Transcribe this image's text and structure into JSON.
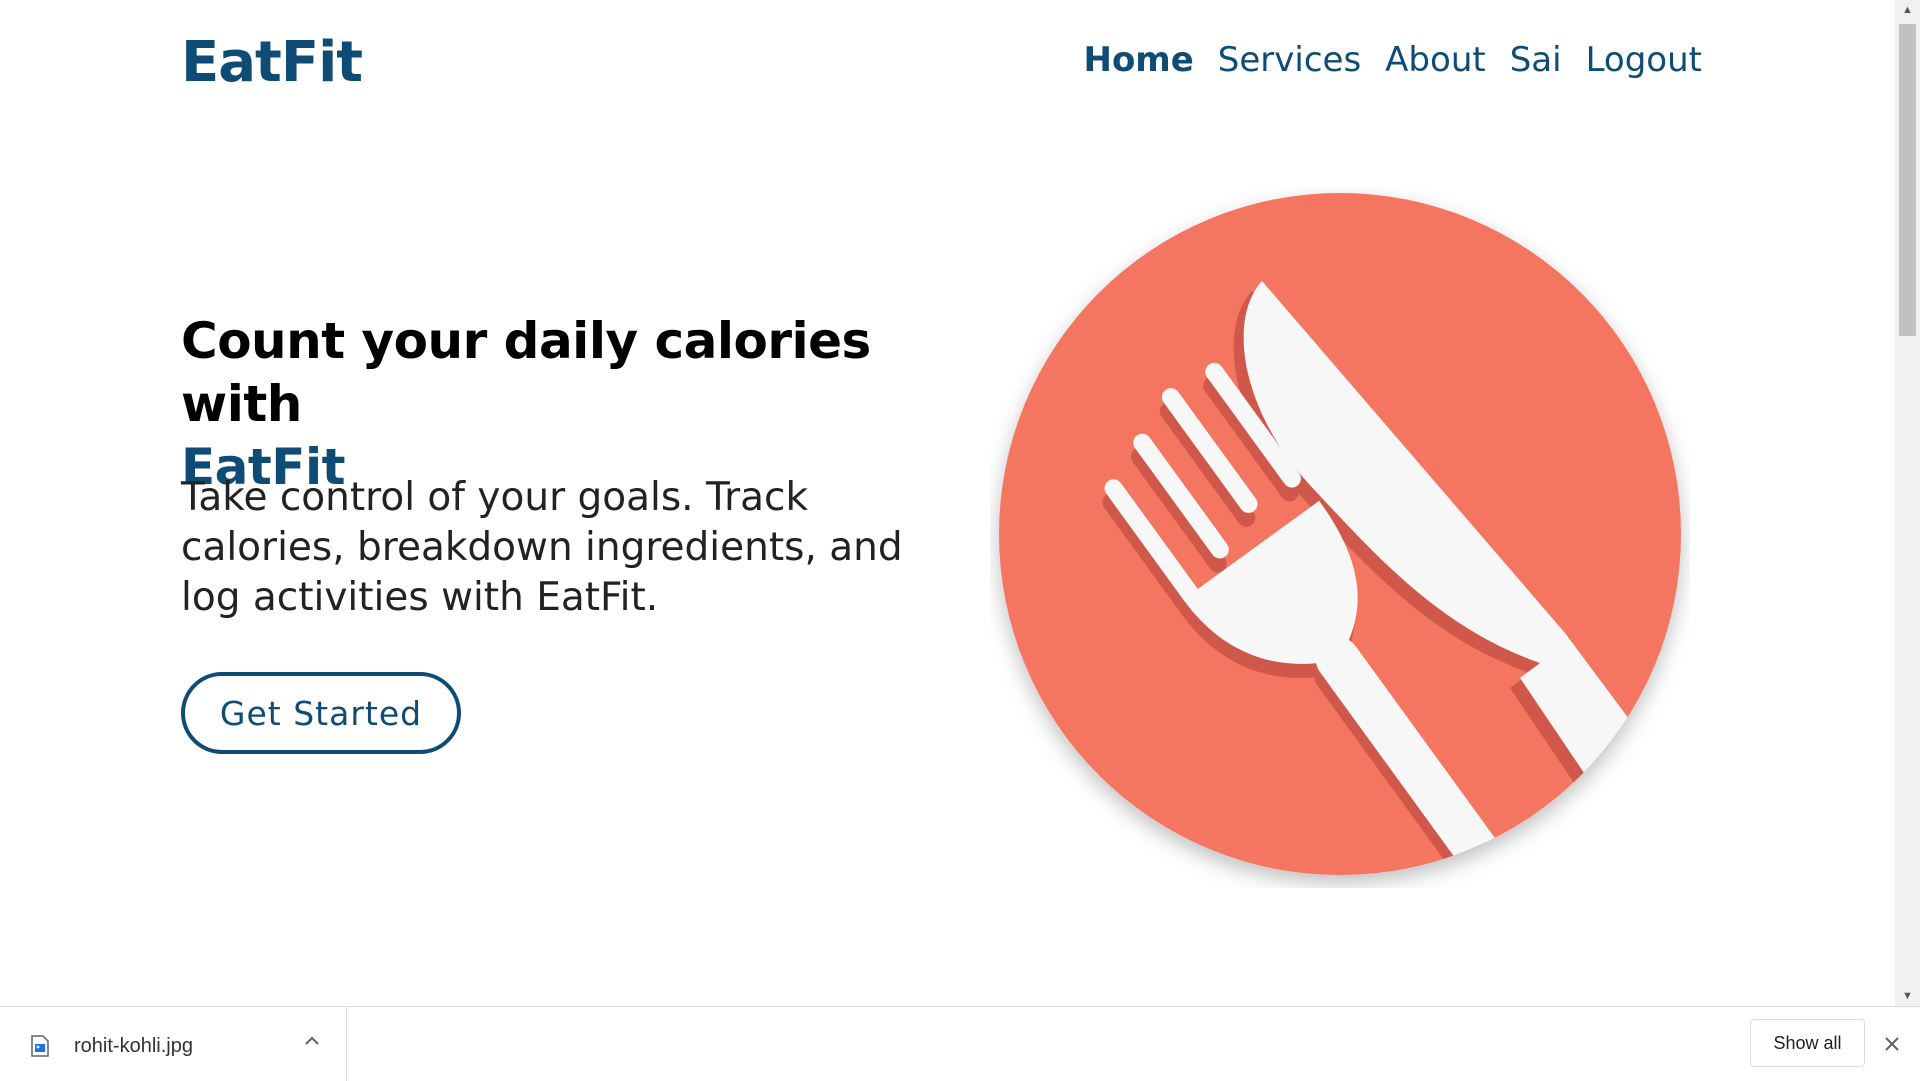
{
  "header": {
    "logo": "EatFit",
    "nav": [
      {
        "label": "Home",
        "active": true
      },
      {
        "label": "Services"
      },
      {
        "label": "About"
      },
      {
        "label": "Sai"
      },
      {
        "label": "Logout"
      }
    ]
  },
  "hero": {
    "title_line1": "Count your daily calories with",
    "title_brand": "EatFit",
    "subtitle": "Take control of your goals. Track calories, breakdown ingredients, and log activities with EatFit.",
    "cta_label": "Get Started",
    "graphic_icon": "fork-knife-plate-icon"
  },
  "colors": {
    "brand": "#0f4c75",
    "plate": "#f47560",
    "utensil": "#f7f7f7",
    "utensil_shadow": "#d0584a"
  },
  "download_bar": {
    "filename": "rohit-kohli.jpg",
    "show_all_label": "Show all"
  }
}
